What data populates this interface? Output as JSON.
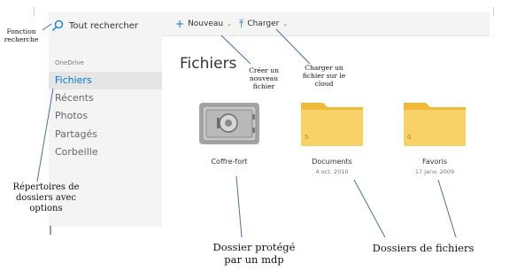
{
  "sidebar": {
    "search_label": "Tout rechercher",
    "section_label": "OneDrive",
    "items": [
      {
        "label": "Fichiers",
        "active": true
      },
      {
        "label": "Récents",
        "active": false
      },
      {
        "label": "Photos",
        "active": false
      },
      {
        "label": "Partagés",
        "active": false
      },
      {
        "label": "Corbeille",
        "active": false
      }
    ]
  },
  "toolbar": {
    "new_label": "Nouveau",
    "upload_label": "Charger"
  },
  "main": {
    "title": "Fichiers",
    "items": [
      {
        "name": "Coffre-fort",
        "date": "",
        "count": ""
      },
      {
        "name": "Documents",
        "date": "4 oct. 2010",
        "count": "5"
      },
      {
        "name": "Favoris",
        "date": "17 janv. 2009",
        "count": "0"
      }
    ]
  },
  "annotations": {
    "search": "Fonction recherche",
    "nav": "Répertoires de dossiers avec options",
    "new": "Créer un nouveau fichier",
    "upload": "Charger un fichier sur le cloud",
    "vault": "Dossier protégé par un mdp",
    "folders": "Dossiers de fichiers"
  },
  "colors": {
    "accent": "#0078d4",
    "folder": "#f8d266",
    "folder_tab": "#f0bb3a",
    "vault": "#9a9a9a"
  }
}
